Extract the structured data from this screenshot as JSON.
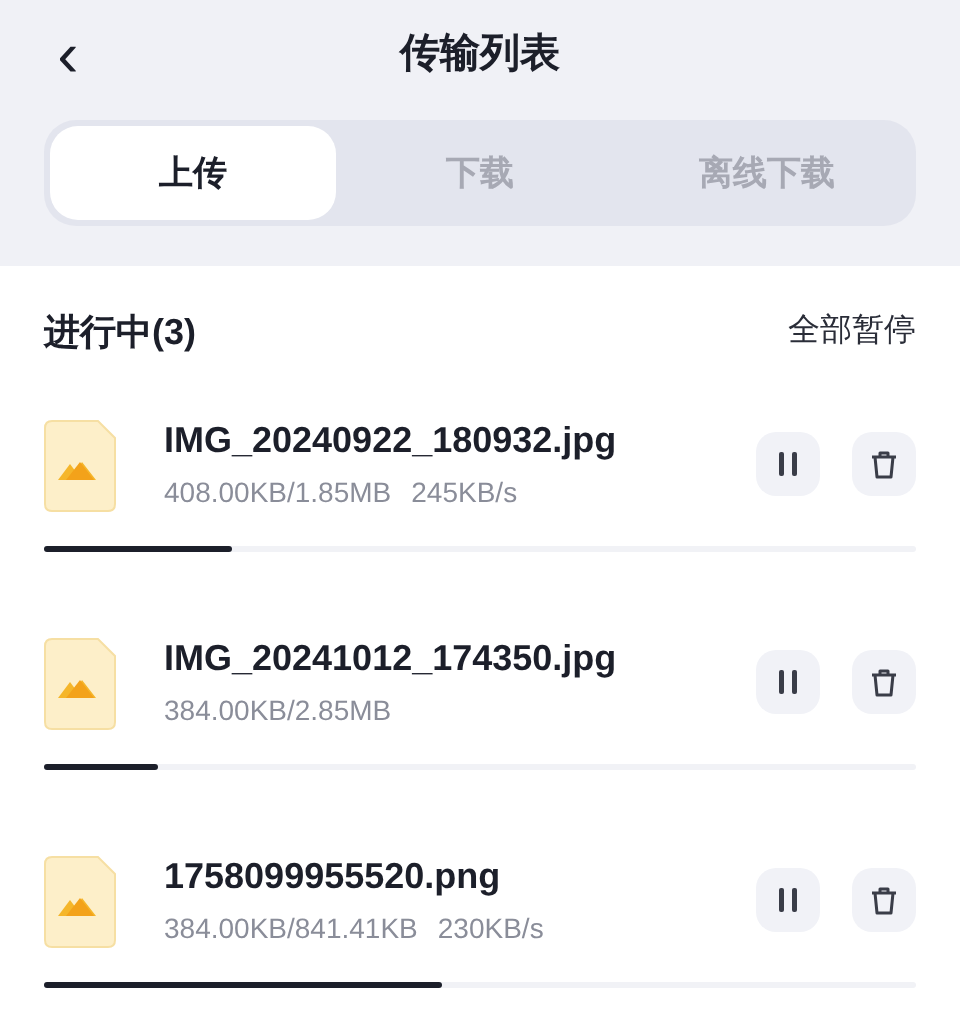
{
  "header": {
    "back": "‹",
    "title": "传输列表"
  },
  "tabs": [
    {
      "label": "上传",
      "selected": true
    },
    {
      "label": "下载",
      "selected": false
    },
    {
      "label": "离线下载",
      "selected": false
    }
  ],
  "section": {
    "title": "进行中(3)",
    "action": "全部暂停"
  },
  "transfers": [
    {
      "name": "IMG_20240922_180932.jpg",
      "progress": "408.00KB/1.85MB",
      "speed": "245KB/s",
      "level": 0.215
    },
    {
      "name": "IMG_20241012_174350.jpg",
      "progress": "384.00KB/2.85MB",
      "level": 0.13
    },
    {
      "name": "1758099955520.png",
      "progress": "384.00KB/841.41KB",
      "speed": "230KB/s",
      "level": 0.456
    }
  ]
}
